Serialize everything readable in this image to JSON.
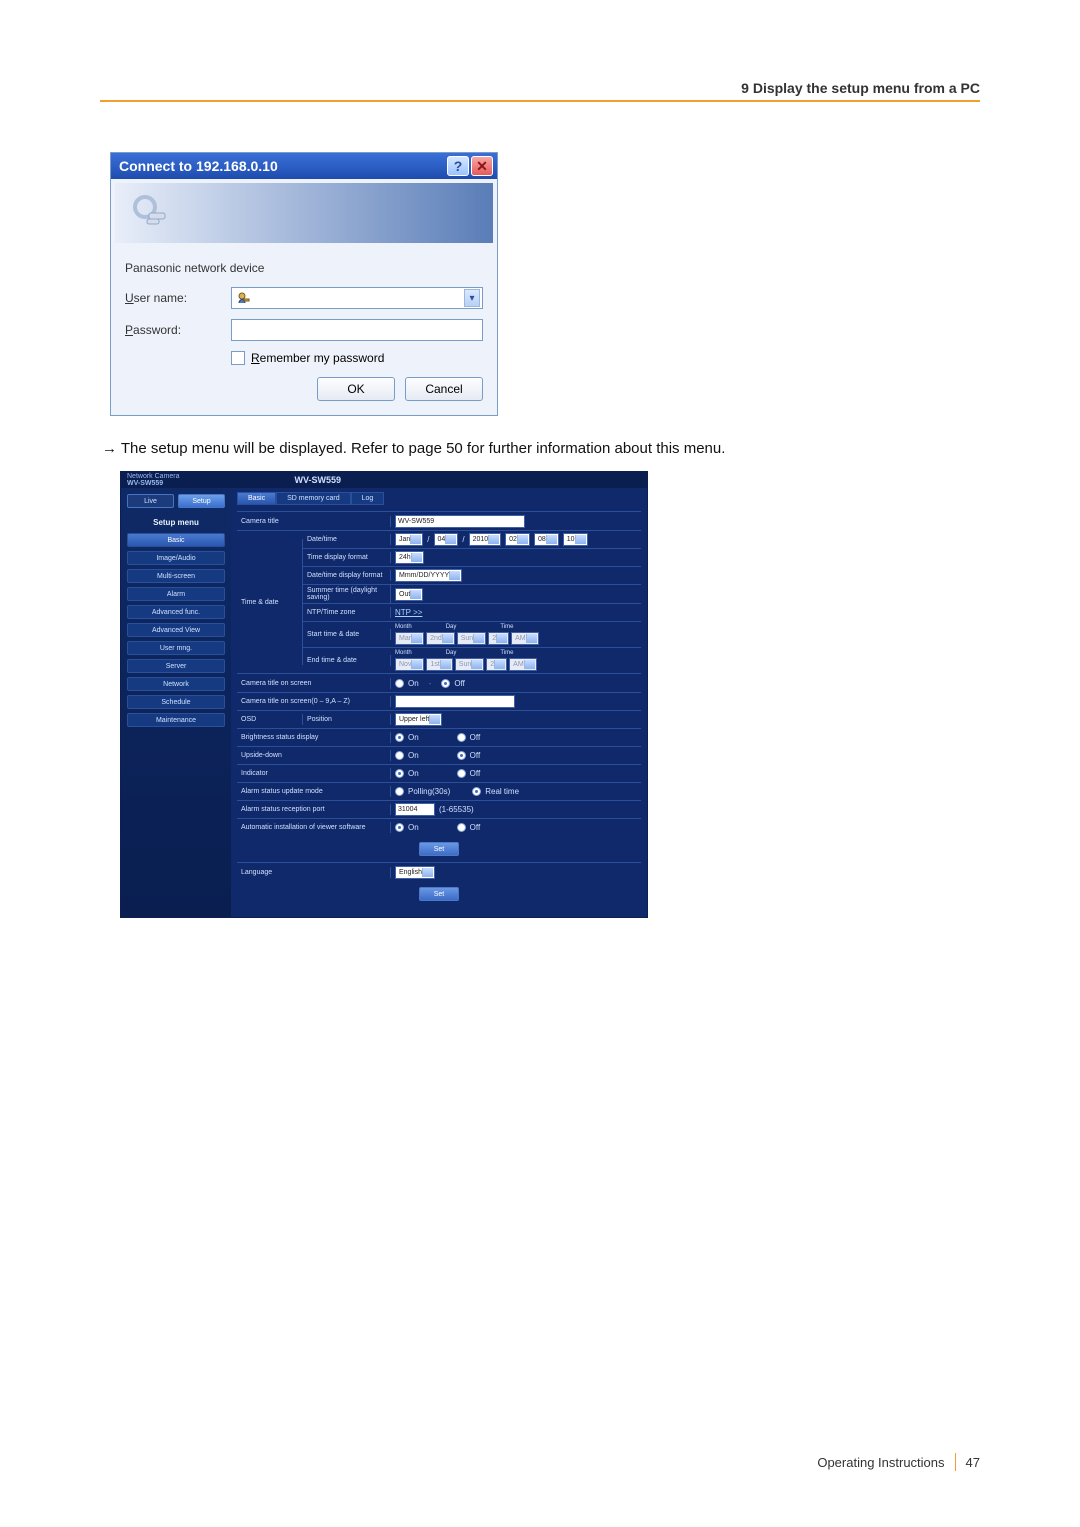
{
  "header": {
    "title": "9 Display the setup menu from a PC"
  },
  "auth": {
    "title": "Connect to 192.168.0.10",
    "description": "Panasonic network device",
    "username_label_pre": "U",
    "username_label_rest": "ser name:",
    "password_label_pre": "P",
    "password_label_rest": "assword:",
    "remember_pre": "R",
    "remember_rest": "emember my password",
    "ok": "OK",
    "cancel": "Cancel"
  },
  "arrow_text": "→  The setup menu will be displayed. Refer to page 50 for further information about this menu.",
  "setup": {
    "top_small": "Network Camera",
    "top_model_small": "WV-SW559",
    "model": "WV-SW559",
    "left_tabs": {
      "live": "Live",
      "setup": "Setup"
    },
    "left_menu_title": "Setup menu",
    "left_items": [
      "Basic",
      "Image/Audio",
      "Multi-screen",
      "Alarm",
      "Advanced func.",
      "Advanced View",
      "User mng.",
      "Server",
      "Network",
      "Schedule",
      "Maintenance"
    ],
    "right_tabs": [
      "Basic",
      "SD memory card",
      "Log"
    ],
    "camera_title_label": "Camera title",
    "camera_title_value": "WV-SW559",
    "time_date_label": "Time & date",
    "rows": {
      "datetime": {
        "label": "Date/time",
        "month": "Jan",
        "sep": "/",
        "day": "04",
        "year": "2010",
        "hh": "02",
        "mm": "08",
        "ss": "10"
      },
      "tdf": {
        "label": "Time display format",
        "value": "24h"
      },
      "ddf": {
        "label": "Date/time display format",
        "value": "Mmm/DD/YYYY"
      },
      "summer": {
        "label": "Summer time (daylight saving)",
        "value": "Out"
      },
      "ntp": {
        "label": "NTP/Time zone",
        "link": "NTP >>"
      },
      "start": {
        "label": "Start time & date",
        "m_label": "Month",
        "d_label": "Day",
        "t_label": "Time",
        "month": "Mar",
        "week": "2nd",
        "dow": "Sun",
        "hour": "2",
        "ap": "AM"
      },
      "end": {
        "label": "End time & date",
        "m_label": "Month",
        "d_label": "Day",
        "t_label": "Time",
        "month": "Nov",
        "week": "1st",
        "dow": "Sun",
        "hour": "2",
        "ap": "AM"
      }
    },
    "thin_rows": {
      "ctos": {
        "label": "Camera title on screen",
        "on": "On",
        "off": "Off"
      },
      "ctos_input": {
        "label": "Camera title on screen(0 – 9,A – Z)"
      },
      "osd": {
        "label": "OSD",
        "sublabel": "Position",
        "value": "Upper left"
      },
      "brightness": {
        "label": "Brightness status display",
        "on": "On",
        "off": "Off"
      },
      "upside": {
        "label": "Upside-down",
        "on": "On",
        "off": "Off"
      },
      "indicator": {
        "label": "Indicator",
        "on": "On",
        "off": "Off"
      },
      "alarm_mode": {
        "label": "Alarm status update mode",
        "polling": "Polling(30s)",
        "realtime": "Real time"
      },
      "alarm_port": {
        "label": "Alarm status reception port",
        "value": "31004",
        "range": "(1-65535)"
      },
      "auto_install": {
        "label": "Automatic installation of viewer software",
        "on": "On",
        "off": "Off"
      },
      "language": {
        "label": "Language",
        "value": "English"
      }
    },
    "set_button": "Set"
  },
  "footer": {
    "text": "Operating Instructions",
    "page": "47"
  }
}
